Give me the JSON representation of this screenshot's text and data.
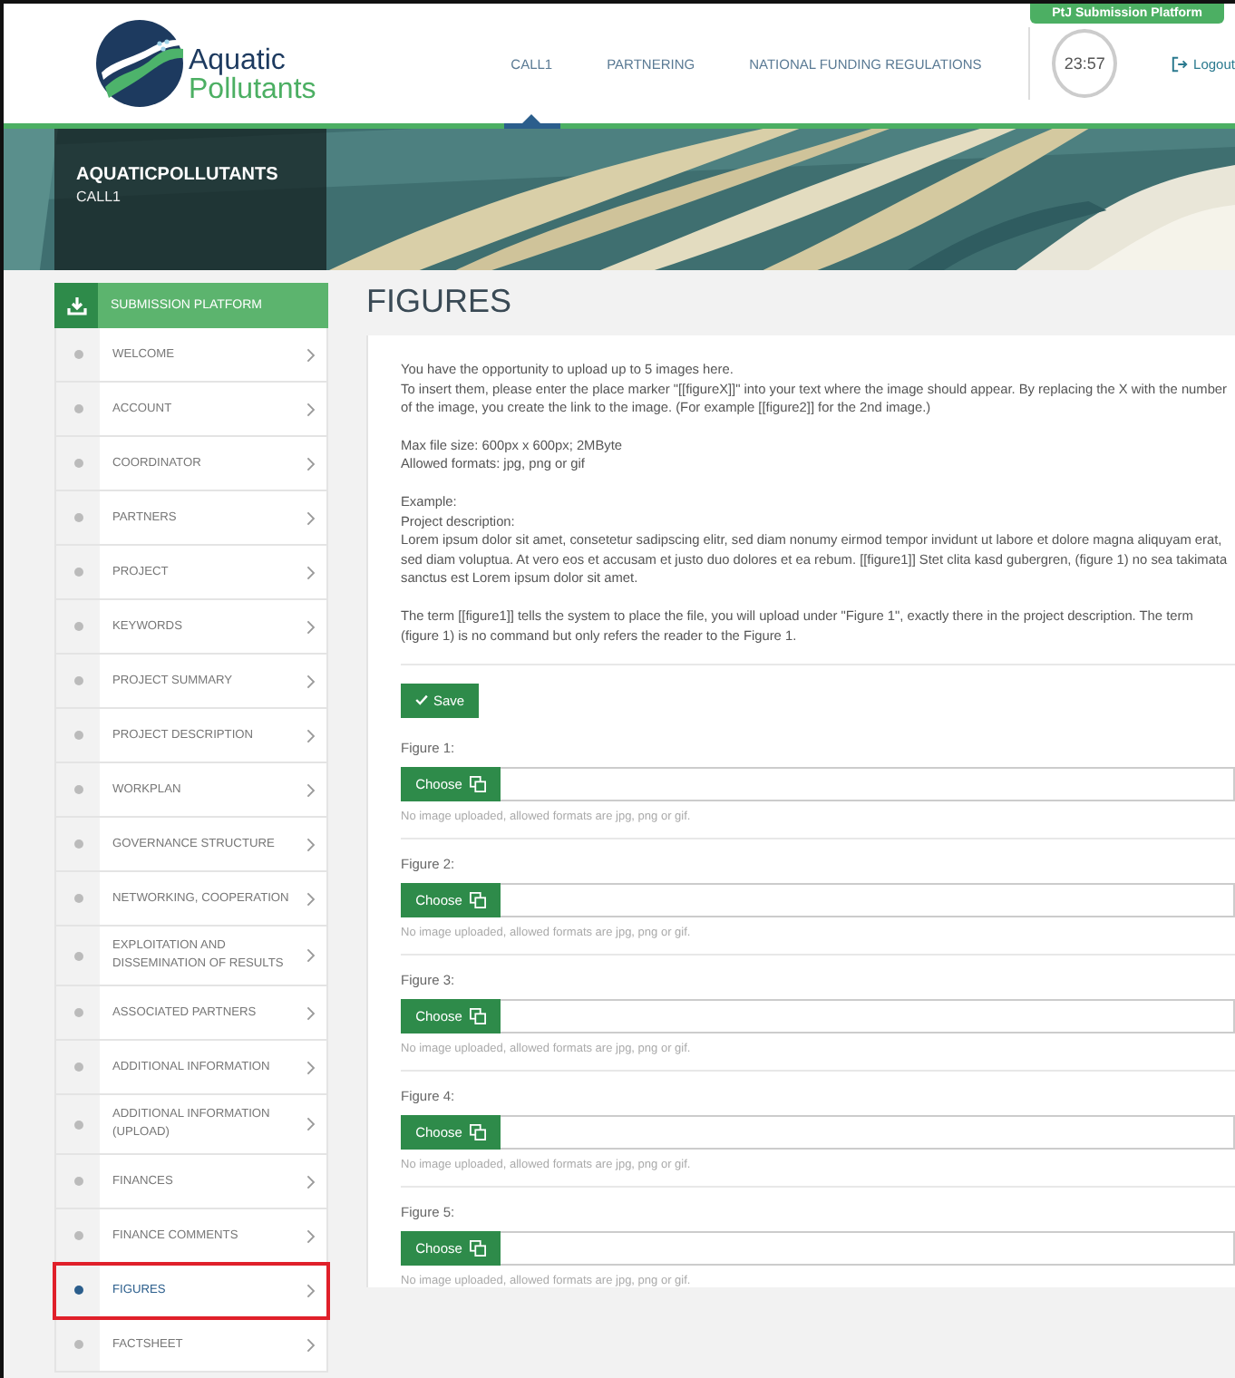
{
  "header": {
    "logo": {
      "line1": "Aquatic",
      "line2": "Pollutants"
    },
    "platform_badge": "PtJ Submission Platform",
    "nav": [
      {
        "label": "CALL1",
        "selected": true
      },
      {
        "label": "PARTNERING",
        "selected": false
      },
      {
        "label": "NATIONAL FUNDING REGULATIONS",
        "selected": false
      }
    ],
    "timer": "23:57",
    "logout": "Logout"
  },
  "banner": {
    "title": "AQUATICPOLLUTANTS",
    "subtitle": "CALL1"
  },
  "sidebar": {
    "title": "SUBMISSION PLATFORM",
    "items": [
      {
        "label": "WELCOME",
        "selected": false,
        "annotated": false
      },
      {
        "label": "ACCOUNT",
        "selected": false,
        "annotated": false
      },
      {
        "label": "COORDINATOR",
        "selected": false,
        "annotated": false
      },
      {
        "label": "PARTNERS",
        "selected": false,
        "annotated": false
      },
      {
        "label": "PROJECT",
        "selected": false,
        "annotated": false
      },
      {
        "label": "KEYWORDS",
        "selected": false,
        "annotated": false
      },
      {
        "label": "PROJECT SUMMARY",
        "selected": false,
        "annotated": false
      },
      {
        "label": "PROJECT DESCRIPTION",
        "selected": false,
        "annotated": false
      },
      {
        "label": "WORKPLAN",
        "selected": false,
        "annotated": false
      },
      {
        "label": "GOVERNANCE STRUCTURE",
        "selected": false,
        "annotated": false
      },
      {
        "label": "NETWORKING, COOPERATION",
        "selected": false,
        "annotated": false
      },
      {
        "label": "EXPLOITATION AND DISSEMINATION OF RESULTS",
        "selected": false,
        "annotated": false
      },
      {
        "label": "ASSOCIATED PARTNERS",
        "selected": false,
        "annotated": false
      },
      {
        "label": "ADDITIONAL INFORMATION",
        "selected": false,
        "annotated": false
      },
      {
        "label": "ADDITIONAL INFORMATION (UPLOAD)",
        "selected": false,
        "annotated": false
      },
      {
        "label": "FINANCES",
        "selected": false,
        "annotated": false
      },
      {
        "label": "FINANCE COMMENTS",
        "selected": false,
        "annotated": false
      },
      {
        "label": "FIGURES",
        "selected": true,
        "annotated": true
      },
      {
        "label": "FACTSHEET",
        "selected": false,
        "annotated": false
      }
    ]
  },
  "main": {
    "title": "FIGURES",
    "intro": [
      [
        "You have the opportunity to upload up to 5 images here.",
        "To insert them, please enter the place marker \"[[figureX]]\" into your text where the image should appear. By replacing the X with the number of the image, you create the link to the image. (For example [[figure2]] for the 2nd image.)"
      ],
      [
        "Max file size: 600px x 600px; 2MByte",
        "Allowed formats: jpg, png or gif"
      ],
      [
        "Example:",
        "Project description:",
        "Lorem ipsum dolor sit amet, consetetur sadipscing elitr, sed diam nonumy eirmod tempor invidunt ut labore et dolore magna aliquyam erat, sed diam voluptua. At vero eos et accusam et justo duo dolores et ea rebum. [[figure1]] Stet clita kasd gubergren, (figure 1) no sea takimata sanctus est Lorem ipsum dolor sit amet."
      ],
      [
        "The term [[figure1]] tells the system to place the file, you will upload under \"Figure 1\", exactly there in the project description. The term (figure 1) is no command but only refers the reader to the Figure 1."
      ]
    ],
    "save": "Save",
    "figures": [
      {
        "label": "Figure 1:",
        "button": "Choose",
        "hint": "No image uploaded, allowed formats are jpg, png or gif."
      },
      {
        "label": "Figure 2:",
        "button": "Choose",
        "hint": "No image uploaded, allowed formats are jpg, png or gif."
      },
      {
        "label": "Figure 3:",
        "button": "Choose",
        "hint": "No image uploaded, allowed formats are jpg, png or gif."
      },
      {
        "label": "Figure 4:",
        "button": "Choose",
        "hint": "No image uploaded, allowed formats are jpg, png or gif."
      },
      {
        "label": "Figure 5:",
        "button": "Choose",
        "hint": "No image uploaded, allowed formats are jpg, png or gif."
      }
    ]
  }
}
